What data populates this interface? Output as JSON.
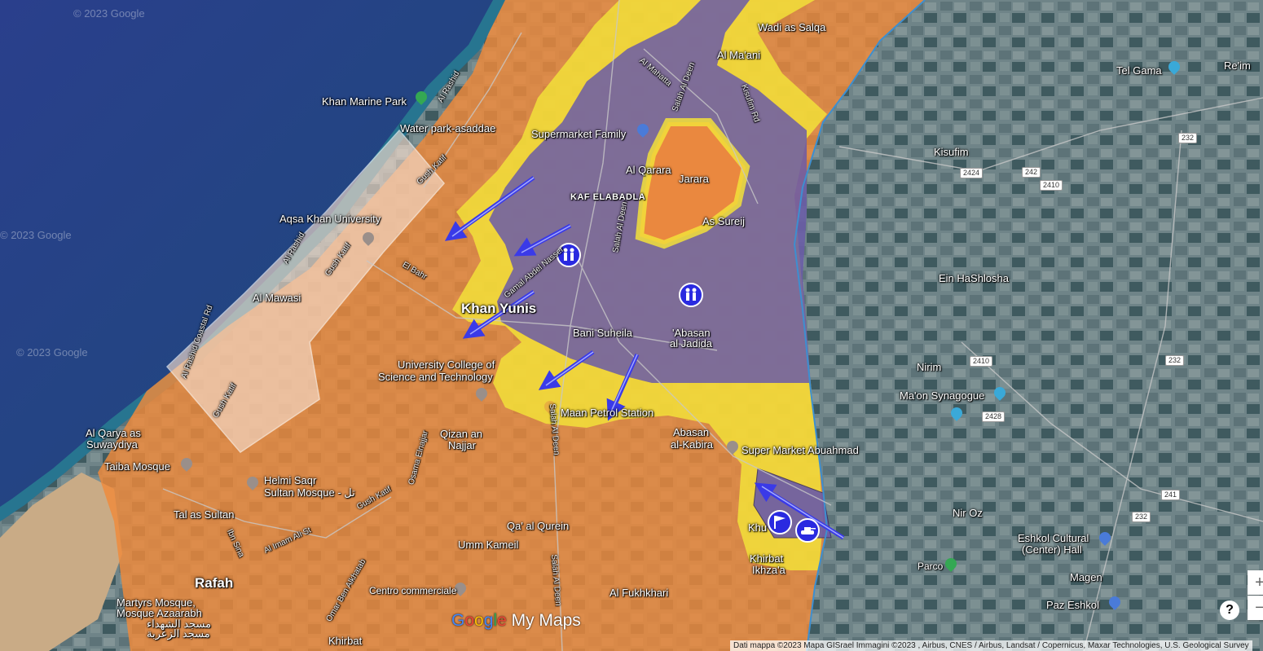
{
  "map": {
    "watermarks": [
      "© 2023 Google",
      "© 2023 Google",
      "© 2023 Google"
    ],
    "places": {
      "wadi_as_salqa": "Wadi as Salqa",
      "al_maani": "Al Ma'ani",
      "tel_gama": "Tel Gama",
      "reim": "Re'im",
      "khan_marine_park": "Khan Marine Park",
      "water_park": "Water park-asaddae",
      "supermarket_family": "Supermarket Family",
      "al_qarara": "Al Qarara",
      "jarara": "Jarara",
      "kaf_elabadla": "KAF ELABADLA",
      "as_sureij": "As Sureij",
      "kisufim": "Kisufim",
      "aqsa_khan_university": "Aqsa Khan University",
      "al_mawasi": "Al Mawasi",
      "ein_hashlosha": "Ein HaShlosha",
      "khan_yunis": "Khan Yunis",
      "bani_suheila": "Bani Suheila",
      "abasan_al_jadida_1": "'Abasan",
      "abasan_al_jadida_2": "al Jadida",
      "university_college_1": "University College of",
      "university_college_2": "Science and Technology",
      "nirim": "Nirim",
      "maon_synagogue": "Ma'on Synagogue",
      "maan_petrol": "Maan Petrol Station",
      "al_qarya_1": "Al Qarya as",
      "al_qarya_2": "Suwaydiya",
      "qizan_1": "Qizan an",
      "qizan_2": "Najjar",
      "abasan_kabira_1": "Abasan",
      "abasan_kabira_2": "al-Kabira",
      "super_market_abuahmad": "Super Market Abuahmad",
      "taiba_mosque": "Taiba Mosque",
      "helmi_1": "Helmi Saqr",
      "helmi_2": "Sultan Mosque - تل",
      "tal_as_sultan": "Tal as Sultan",
      "khu": "Khu",
      "nir_oz": "Nir Oz",
      "qaa_al_qurein": "Qa' al Qurein",
      "umm_kameil": "Umm Kameil",
      "eshkol_1": "Eshkol Cultural",
      "eshkol_2": "(Center) Hall",
      "khirbat_ikhzaa_1": "Khirbat",
      "khirbat_ikhzaa_2": "Ikhza'a",
      "parco": "Parco",
      "rafah": "Rafah",
      "magen": "Magen",
      "martyrs_1": "Martyrs Mosque,",
      "martyrs_2": "Mosque Azaarabh",
      "martyrs_3": "مسجد الشهداء",
      "martyrs_4": "مسجد الزعربة",
      "centro_commerciale": "Centro commerciale",
      "al_fukhkhari": "Al Fukhkhari",
      "paz_eshkol": "Paz Eshkol",
      "khirbat_bottom": "Khirbat"
    },
    "roads": {
      "al_rashid_n": "Al Rashid",
      "al_mahatta": "Al Mahatta",
      "salah_al_deen_n": "Salah Al Deen",
      "kisufim_rd": "Kisufim Rd",
      "gush_katif_1": "Gush Katif",
      "salah_al_deen_mid": "Salah Al Deen",
      "al_rashid_mid": "Al Rashid",
      "gush_katif_2": "Gush Katif",
      "el_bahr": "El Bahr",
      "gamal_abdel_nasser": "Gamal Abdel Nasser",
      "al_rashid_coastal": "Al Rashid Coastal Rd",
      "gush_katif_3": "Gush Katif",
      "salah_al_deen_s": "Salah Al Deen",
      "osama_elnajjar": "Osama Elnajjar",
      "gush_katif_4": "Gush Katif",
      "ibn_sina": "Ibn Sina",
      "al_imam_ali": "Al Imam Ali St",
      "omar_ben_alkhatab": "Omar Ben Alkhatab",
      "salah_al_deen_bottom": "Salah Al Deen"
    },
    "shields": [
      "232",
      "2424",
      "242",
      "2410",
      "2410",
      "232",
      "2428",
      "241",
      "232"
    ],
    "logo": {
      "g1": "G",
      "g2": "o",
      "g3": "o",
      "g4": "g",
      "g5": "l",
      "g6": "e",
      "rest": " My Maps"
    },
    "controls": {
      "zoom_in": "+",
      "zoom_out": "−",
      "help": "?"
    },
    "attribution": "Dati mappa ©2023 Mapa GISrael Immagini ©2023 , Airbus, CNES / Airbus, Landsat / Copernicus, Maxar Technologies, U.S. Geological Survey",
    "colors": {
      "controlled_zone": "#f08a3a",
      "contested_zone": "#f2e03a",
      "occupied_zone": "#6a5aa8",
      "evacuated_zone": "#f5dccc",
      "arrow": "#3a3ae8",
      "sea": "#1f3f8a"
    },
    "icons": [
      "people-icon",
      "people-icon",
      "flag-icon",
      "tank-icon",
      "park-pin-icon",
      "shopping-pin-icon",
      "school-pin-icon",
      "fuel-pin-icon",
      "place-pin-icon"
    ]
  }
}
